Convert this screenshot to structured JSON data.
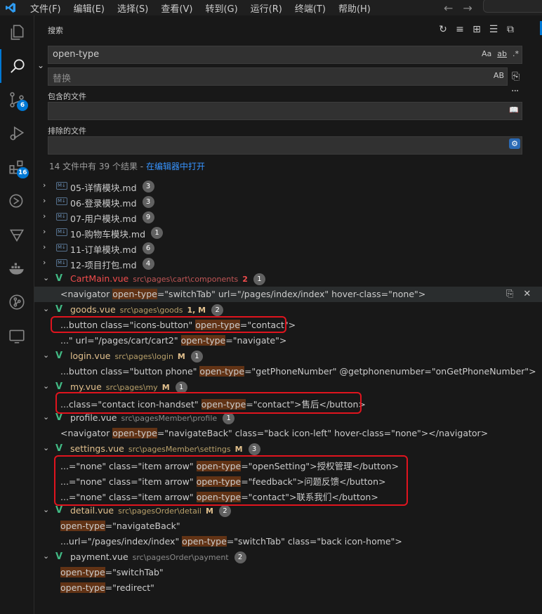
{
  "menu": [
    "文件(F)",
    "编辑(E)",
    "选择(S)",
    "查看(V)",
    "转到(G)",
    "运行(R)",
    "终端(T)",
    "帮助(H)"
  ],
  "nav": {
    "back": "←",
    "forward": "→"
  },
  "activity": {
    "scm_badge": "6",
    "extensions_badge": "16"
  },
  "search": {
    "title": "搜索",
    "query": "open-type",
    "opt_case": "Aa",
    "opt_word": "ab",
    "opt_regex": ".*",
    "replace_placeholder": "替换",
    "replace_opt": "AB",
    "include_label": "包含的文件",
    "exclude_label": "排除的文件",
    "summary_text": "14 文件中有 39 个结果 - ",
    "summary_link": "在编辑器中打开"
  },
  "results": [
    {
      "type": "file",
      "kind": "md",
      "name": "05-详情模块.md",
      "count": "3"
    },
    {
      "type": "file",
      "kind": "md",
      "name": "06-登录模块.md",
      "count": "3"
    },
    {
      "type": "file",
      "kind": "md",
      "name": "07-用户模块.md",
      "count": "9"
    },
    {
      "type": "file",
      "kind": "md",
      "name": "10-购物车模块.md",
      "count": "1"
    },
    {
      "type": "file",
      "kind": "md",
      "name": "11-订单模块.md",
      "count": "6"
    },
    {
      "type": "file",
      "kind": "md",
      "name": "12-项目打包.md",
      "count": "4"
    },
    {
      "type": "file",
      "kind": "vue",
      "state": "err",
      "name": "CartMain.vue",
      "path": "src\\pages\\cart\\components",
      "git": "2",
      "count": "1"
    },
    {
      "type": "match",
      "pre": "<navigator ",
      "hit": "open-type",
      "post": "=\"switchTab\" url=\"/pages/index/index\" hover-class=\"none\">",
      "selected": true
    },
    {
      "type": "file",
      "kind": "vue",
      "state": "mod",
      "name": "goods.vue",
      "path": "src\\pages\\goods",
      "git": "1, M",
      "count": "2"
    },
    {
      "type": "match",
      "pre": "...button class=\"icons-button\" ",
      "hit": "open-type",
      "post": "=\"contact\">"
    },
    {
      "type": "match",
      "pre": "...\" url=\"/pages/cart/cart2\" ",
      "hit": "open-type",
      "post": "=\"navigate\">"
    },
    {
      "type": "file",
      "kind": "vue",
      "state": "mod",
      "name": "login.vue",
      "path": "src\\pages\\login",
      "git": "M",
      "count": "1"
    },
    {
      "type": "match",
      "pre": "...button class=\"button phone\" ",
      "hit": "open-type",
      "post": "=\"getPhoneNumber\" @getphonenumber=\"onGetPhoneNumber\">"
    },
    {
      "type": "file",
      "kind": "vue",
      "state": "mod",
      "name": "my.vue",
      "path": "src\\pages\\my",
      "git": "M",
      "count": "1"
    },
    {
      "type": "match",
      "pre": "...class=\"contact icon-handset\" ",
      "hit": "open-type",
      "post": "=\"contact\">售后</button>"
    },
    {
      "type": "file",
      "kind": "vue",
      "state": "",
      "name": "profile.vue",
      "path": "src\\pagesMember\\profile",
      "git": "",
      "count": "1"
    },
    {
      "type": "match",
      "pre": "<navigator ",
      "hit": "open-type",
      "post": "=\"navigateBack\" class=\"back icon-left\" hover-class=\"none\"></navigator>"
    },
    {
      "type": "file",
      "kind": "vue",
      "state": "mod",
      "name": "settings.vue",
      "path": "src\\pagesMember\\settings",
      "git": "M",
      "count": "3"
    },
    {
      "type": "match",
      "pre": "...=\"none\" class=\"item arrow\" ",
      "hit": "open-type",
      "post": "=\"openSetting\">授权管理</button>"
    },
    {
      "type": "match",
      "pre": "...=\"none\" class=\"item arrow\" ",
      "hit": "open-type",
      "post": "=\"feedback\">问题反馈</button>"
    },
    {
      "type": "match",
      "pre": "...=\"none\" class=\"item arrow\" ",
      "hit": "open-type",
      "post": "=\"contact\">联系我们</button>"
    },
    {
      "type": "file",
      "kind": "vue",
      "state": "mod",
      "name": "detail.vue",
      "path": "src\\pagesOrder\\detail",
      "git": "M",
      "count": "2"
    },
    {
      "type": "match",
      "pre": "",
      "hit": "open-type",
      "post": "=\"navigateBack\""
    },
    {
      "type": "match",
      "pre": "...url=\"/pages/index/index\" ",
      "hit": "open-type",
      "post": "=\"switchTab\" class=\"back icon-home\">"
    },
    {
      "type": "file",
      "kind": "vue",
      "state": "",
      "name": "payment.vue",
      "path": "src\\pagesOrder\\payment",
      "git": "",
      "count": "2"
    },
    {
      "type": "match",
      "pre": "",
      "hit": "open-type",
      "post": "=\"switchTab\""
    },
    {
      "type": "match",
      "pre": "",
      "hit": "open-type",
      "post": "=\"redirect\""
    }
  ]
}
